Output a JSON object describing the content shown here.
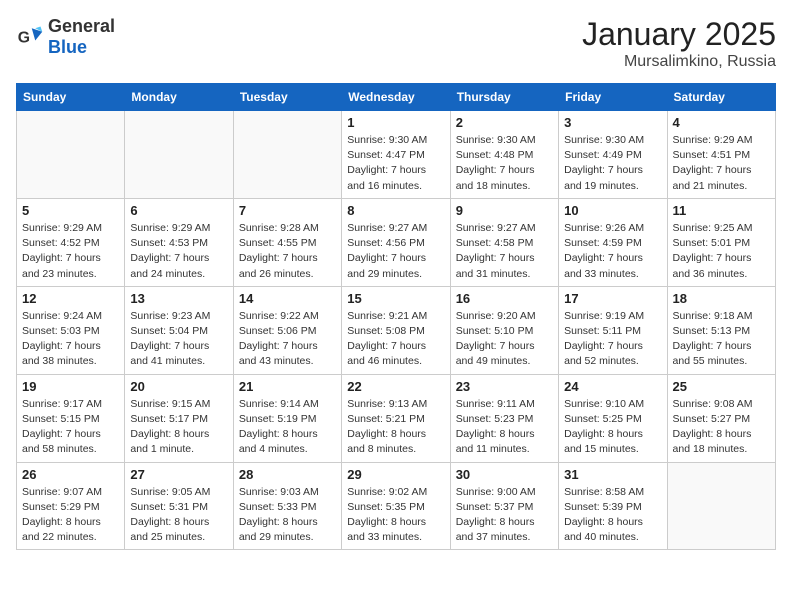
{
  "header": {
    "logo_general": "General",
    "logo_blue": "Blue",
    "month": "January 2025",
    "location": "Mursalimkino, Russia"
  },
  "weekdays": [
    "Sunday",
    "Monday",
    "Tuesday",
    "Wednesday",
    "Thursday",
    "Friday",
    "Saturday"
  ],
  "weeks": [
    [
      {
        "day": "",
        "info": ""
      },
      {
        "day": "",
        "info": ""
      },
      {
        "day": "",
        "info": ""
      },
      {
        "day": "1",
        "info": "Sunrise: 9:30 AM\nSunset: 4:47 PM\nDaylight: 7 hours\nand 16 minutes."
      },
      {
        "day": "2",
        "info": "Sunrise: 9:30 AM\nSunset: 4:48 PM\nDaylight: 7 hours\nand 18 minutes."
      },
      {
        "day": "3",
        "info": "Sunrise: 9:30 AM\nSunset: 4:49 PM\nDaylight: 7 hours\nand 19 minutes."
      },
      {
        "day": "4",
        "info": "Sunrise: 9:29 AM\nSunset: 4:51 PM\nDaylight: 7 hours\nand 21 minutes."
      }
    ],
    [
      {
        "day": "5",
        "info": "Sunrise: 9:29 AM\nSunset: 4:52 PM\nDaylight: 7 hours\nand 23 minutes."
      },
      {
        "day": "6",
        "info": "Sunrise: 9:29 AM\nSunset: 4:53 PM\nDaylight: 7 hours\nand 24 minutes."
      },
      {
        "day": "7",
        "info": "Sunrise: 9:28 AM\nSunset: 4:55 PM\nDaylight: 7 hours\nand 26 minutes."
      },
      {
        "day": "8",
        "info": "Sunrise: 9:27 AM\nSunset: 4:56 PM\nDaylight: 7 hours\nand 29 minutes."
      },
      {
        "day": "9",
        "info": "Sunrise: 9:27 AM\nSunset: 4:58 PM\nDaylight: 7 hours\nand 31 minutes."
      },
      {
        "day": "10",
        "info": "Sunrise: 9:26 AM\nSunset: 4:59 PM\nDaylight: 7 hours\nand 33 minutes."
      },
      {
        "day": "11",
        "info": "Sunrise: 9:25 AM\nSunset: 5:01 PM\nDaylight: 7 hours\nand 36 minutes."
      }
    ],
    [
      {
        "day": "12",
        "info": "Sunrise: 9:24 AM\nSunset: 5:03 PM\nDaylight: 7 hours\nand 38 minutes."
      },
      {
        "day": "13",
        "info": "Sunrise: 9:23 AM\nSunset: 5:04 PM\nDaylight: 7 hours\nand 41 minutes."
      },
      {
        "day": "14",
        "info": "Sunrise: 9:22 AM\nSunset: 5:06 PM\nDaylight: 7 hours\nand 43 minutes."
      },
      {
        "day": "15",
        "info": "Sunrise: 9:21 AM\nSunset: 5:08 PM\nDaylight: 7 hours\nand 46 minutes."
      },
      {
        "day": "16",
        "info": "Sunrise: 9:20 AM\nSunset: 5:10 PM\nDaylight: 7 hours\nand 49 minutes."
      },
      {
        "day": "17",
        "info": "Sunrise: 9:19 AM\nSunset: 5:11 PM\nDaylight: 7 hours\nand 52 minutes."
      },
      {
        "day": "18",
        "info": "Sunrise: 9:18 AM\nSunset: 5:13 PM\nDaylight: 7 hours\nand 55 minutes."
      }
    ],
    [
      {
        "day": "19",
        "info": "Sunrise: 9:17 AM\nSunset: 5:15 PM\nDaylight: 7 hours\nand 58 minutes."
      },
      {
        "day": "20",
        "info": "Sunrise: 9:15 AM\nSunset: 5:17 PM\nDaylight: 8 hours\nand 1 minute."
      },
      {
        "day": "21",
        "info": "Sunrise: 9:14 AM\nSunset: 5:19 PM\nDaylight: 8 hours\nand 4 minutes."
      },
      {
        "day": "22",
        "info": "Sunrise: 9:13 AM\nSunset: 5:21 PM\nDaylight: 8 hours\nand 8 minutes."
      },
      {
        "day": "23",
        "info": "Sunrise: 9:11 AM\nSunset: 5:23 PM\nDaylight: 8 hours\nand 11 minutes."
      },
      {
        "day": "24",
        "info": "Sunrise: 9:10 AM\nSunset: 5:25 PM\nDaylight: 8 hours\nand 15 minutes."
      },
      {
        "day": "25",
        "info": "Sunrise: 9:08 AM\nSunset: 5:27 PM\nDaylight: 8 hours\nand 18 minutes."
      }
    ],
    [
      {
        "day": "26",
        "info": "Sunrise: 9:07 AM\nSunset: 5:29 PM\nDaylight: 8 hours\nand 22 minutes."
      },
      {
        "day": "27",
        "info": "Sunrise: 9:05 AM\nSunset: 5:31 PM\nDaylight: 8 hours\nand 25 minutes."
      },
      {
        "day": "28",
        "info": "Sunrise: 9:03 AM\nSunset: 5:33 PM\nDaylight: 8 hours\nand 29 minutes."
      },
      {
        "day": "29",
        "info": "Sunrise: 9:02 AM\nSunset: 5:35 PM\nDaylight: 8 hours\nand 33 minutes."
      },
      {
        "day": "30",
        "info": "Sunrise: 9:00 AM\nSunset: 5:37 PM\nDaylight: 8 hours\nand 37 minutes."
      },
      {
        "day": "31",
        "info": "Sunrise: 8:58 AM\nSunset: 5:39 PM\nDaylight: 8 hours\nand 40 minutes."
      },
      {
        "day": "",
        "info": ""
      }
    ]
  ]
}
